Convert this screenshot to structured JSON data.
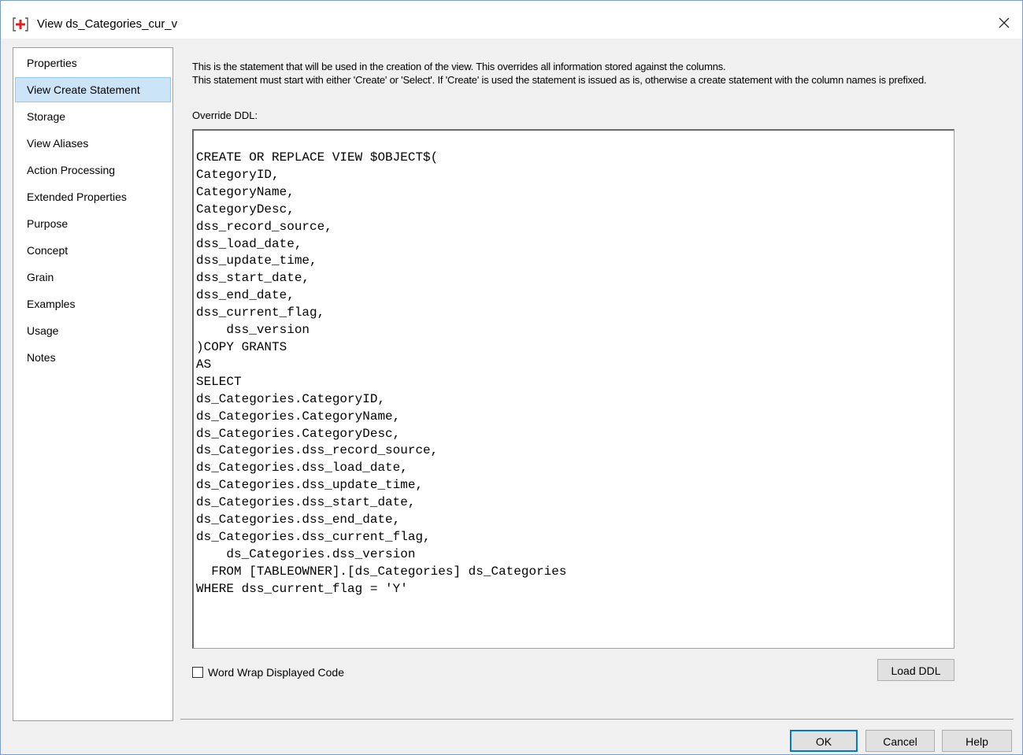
{
  "window": {
    "title": "View ds_Categories_cur_v",
    "icon": "view-add-icon",
    "close_icon": "close-icon"
  },
  "sidebar": {
    "items": [
      {
        "label": "Properties",
        "selected": false
      },
      {
        "label": "View Create Statement",
        "selected": true
      },
      {
        "label": "Storage",
        "selected": false
      },
      {
        "label": "View Aliases",
        "selected": false
      },
      {
        "label": "Action Processing",
        "selected": false
      },
      {
        "label": "Extended Properties",
        "selected": false
      },
      {
        "label": "Purpose",
        "selected": false
      },
      {
        "label": "Concept",
        "selected": false
      },
      {
        "label": "Grain",
        "selected": false
      },
      {
        "label": "Examples",
        "selected": false
      },
      {
        "label": "Usage",
        "selected": false
      },
      {
        "label": "Notes",
        "selected": false
      }
    ]
  },
  "main": {
    "description_line1": "This is the statement that will be used in the creation of the view. This overrides all information stored against the columns.",
    "description_line2": "This statement must start with either 'Create' or 'Select'. If 'Create' is used the statement is issued as is, otherwise a create statement with the column names is prefixed.",
    "override_label": "Override DDL:",
    "ddl_code": "CREATE OR REPLACE VIEW $OBJECT$(\nCategoryID,\nCategoryName,\nCategoryDesc,\ndss_record_source,\ndss_load_date,\ndss_update_time,\ndss_start_date,\ndss_end_date,\ndss_current_flag,\n    dss_version\n)COPY GRANTS\nAS\nSELECT\nds_Categories.CategoryID,\nds_Categories.CategoryName,\nds_Categories.CategoryDesc,\nds_Categories.dss_record_source,\nds_Categories.dss_load_date,\nds_Categories.dss_update_time,\nds_Categories.dss_start_date,\nds_Categories.dss_end_date,\nds_Categories.dss_current_flag,\n    ds_Categories.dss_version\n  FROM [TABLEOWNER].[ds_Categories] ds_Categories\nWHERE dss_current_flag = 'Y'",
    "word_wrap_label": "Word Wrap Displayed Code",
    "word_wrap_checked": false,
    "load_ddl_label": "Load DDL"
  },
  "footer": {
    "ok_label": "OK",
    "cancel_label": "Cancel",
    "help_label": "Help"
  },
  "colors": {
    "selected_bg": "#cce4f7",
    "selected_border": "#99c9ef",
    "icon_red": "#e02020",
    "default_button_border": "#0078d7"
  }
}
